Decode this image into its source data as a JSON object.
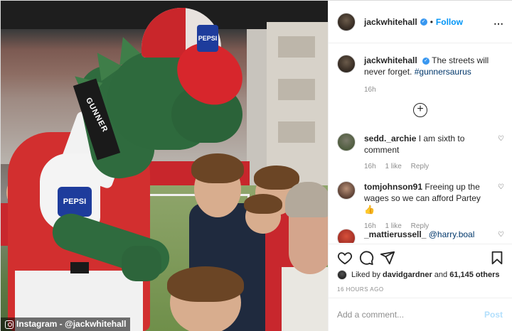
{
  "photo": {
    "scarf_text": "GUNNER",
    "pepsi_label": "PEPSI",
    "watermark": "Instagram - @jackwhitehall"
  },
  "header": {
    "username": "jackwhitehall",
    "separator": "•",
    "follow_label": "Follow",
    "more_icon": "more-horizontal-icon"
  },
  "caption": {
    "username": "jackwhitehall",
    "text": "The streets will never forget.",
    "hashtag": "#gunnersaurus",
    "time": "16h"
  },
  "load_more_icon": "plus-circle-icon",
  "comments": [
    {
      "username": "sedd._archie",
      "text": "I am sixth to comment",
      "time": "16h",
      "likes": "1 like",
      "reply": "Reply"
    },
    {
      "username": "tomjohnson91",
      "text": "Freeing up the wages so we can afford Partey 👍",
      "time": "16h",
      "likes": "1 like",
      "reply": "Reply"
    },
    {
      "username": "_mattierussell_",
      "mention": "@harry.boal"
    }
  ],
  "actions": {
    "like_icon": "heart-icon",
    "comment_icon": "comment-icon",
    "share_icon": "send-icon",
    "save_icon": "bookmark-icon",
    "liked_by_prefix": "Liked by",
    "liked_by_user": "davidgardner",
    "liked_by_and": "and",
    "liked_by_count": "61,145 others",
    "timestamp": "16 HOURS AGO"
  },
  "add_comment": {
    "placeholder": "Add a comment...",
    "post_label": "Post"
  },
  "colors": {
    "accent": "#0095f6",
    "verified": "#3897f0",
    "post_disabled": "#b2dffc",
    "hashtag": "#00376b"
  }
}
